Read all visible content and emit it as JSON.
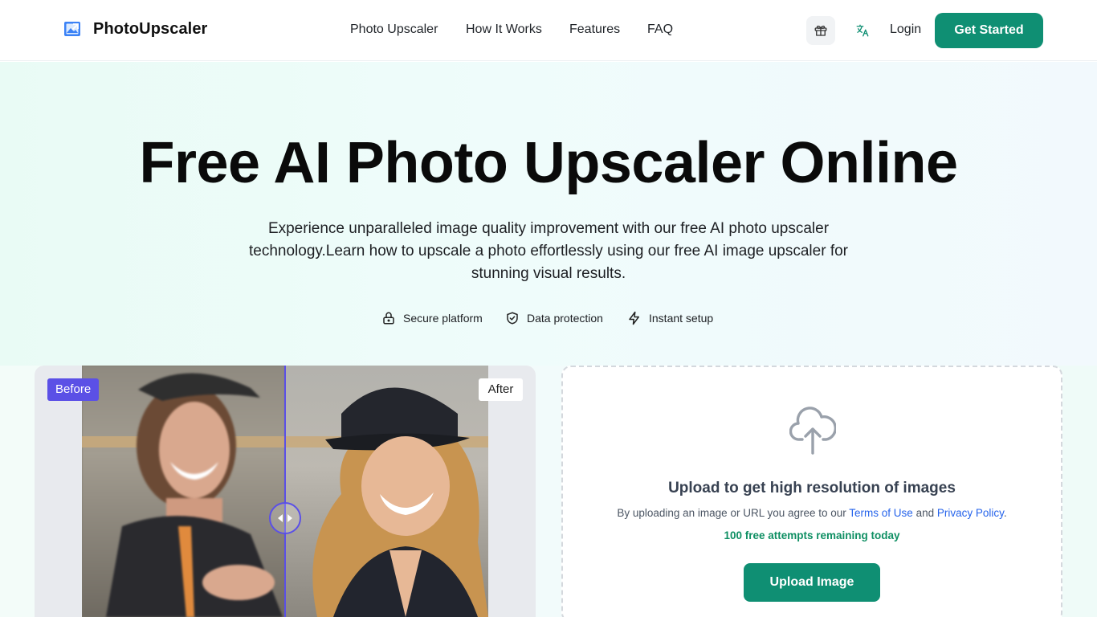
{
  "brand": {
    "name": "PhotoUpscaler",
    "logo_icon": "image-upscale-icon",
    "accent": "#3b82f6"
  },
  "nav": {
    "links": [
      "Photo Upscaler",
      "How It Works",
      "Features",
      "FAQ"
    ],
    "gift_icon": "gift-icon",
    "language_icon": "translate-icon",
    "login_label": "Login",
    "cta_label": "Get Started",
    "cta_color": "#0f8f73"
  },
  "hero": {
    "title": "Free AI Photo Upscaler Online",
    "description": "Experience unparalleled image quality improvement with our free AI photo upscaler technology.Learn how to upscale a photo effortlessly using our free AI image upscaler for stunning visual results.",
    "features": [
      {
        "icon": "lock-icon",
        "label": "Secure platform"
      },
      {
        "icon": "shield-check-icon",
        "label": "Data protection"
      },
      {
        "icon": "lightning-icon",
        "label": "Instant setup"
      }
    ]
  },
  "compare": {
    "before_label": "Before",
    "after_label": "After",
    "handle_icon": "slider-arrows-icon",
    "accent": "#5b50e6"
  },
  "upload": {
    "icon": "cloud-upload-icon",
    "title": "Upload to get high resolution of images",
    "terms_prefix": "By uploading an image or URL you agree to our ",
    "terms_link": "Terms of Use",
    "terms_and": " and ",
    "privacy_link": "Privacy Policy",
    "terms_suffix": ".",
    "remaining": "100 free attempts remaining today",
    "button_label": "Upload Image"
  }
}
